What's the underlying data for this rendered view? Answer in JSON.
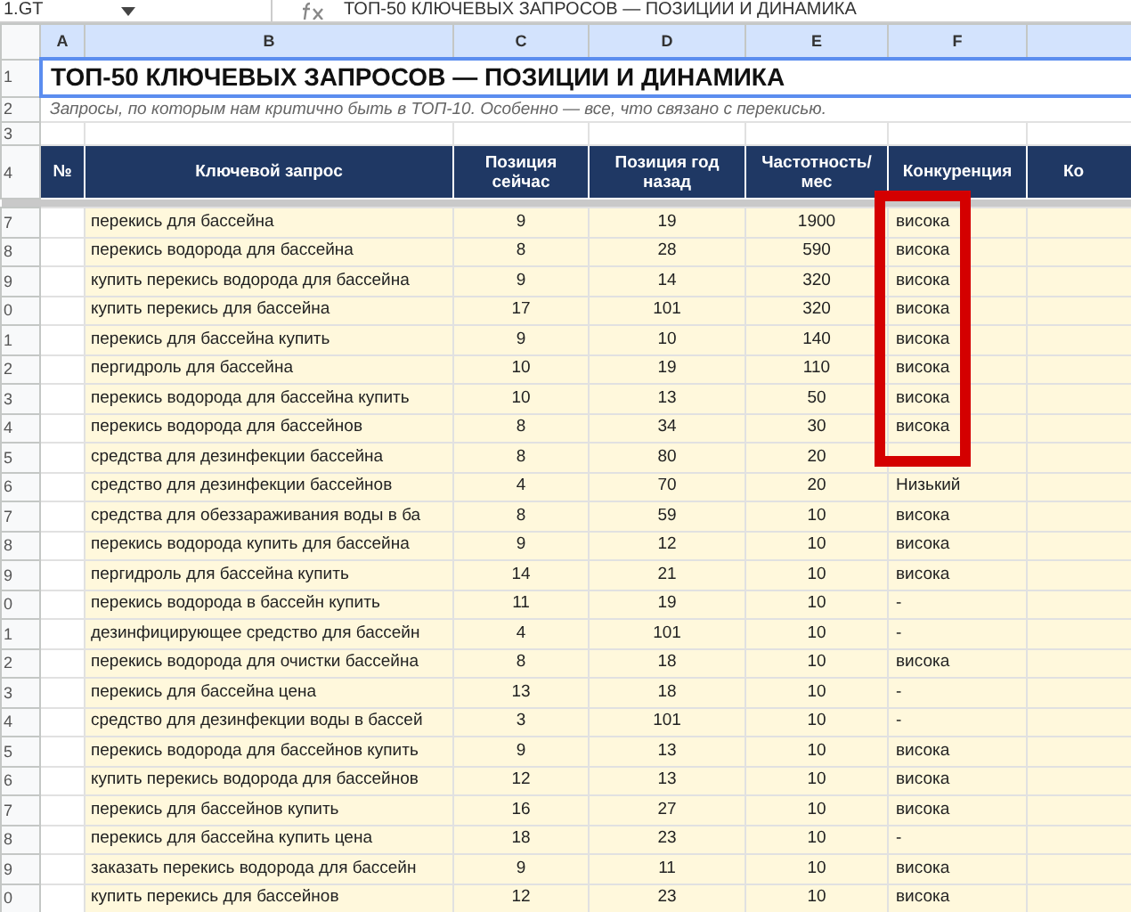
{
  "formula_bar": {
    "name_box": "1.GT",
    "formula": "ТОП-50 КЛЮЧЕВЫХ ЗАПРОСОВ — ПОЗИЦИИ И ДИНАМИКА"
  },
  "column_letters": [
    "A",
    "B",
    "C",
    "D",
    "E",
    "F"
  ],
  "title_row": {
    "row_number": "1",
    "text": "ТОП-50 КЛЮЧЕВЫХ ЗАПРОСОВ — ПОЗИЦИИ И ДИНАМИКА"
  },
  "subtitle_row": {
    "row_number": "2",
    "text": "Запросы, по которым нам критично быть в ТОП-10. Особенно — все, что связано с перекисью."
  },
  "empty_row": {
    "row_number": "3"
  },
  "header_row": {
    "row_number": "4",
    "cells": [
      "№",
      "Ключевой запрос",
      "Позиция сейчас",
      "Позиция год назад",
      "Частотность/ мес",
      "Конкуренция",
      "Ко"
    ]
  },
  "rows": [
    {
      "row_number": "7",
      "query": "перекись для бассейна",
      "position_now": "9",
      "position_year_ago": "19",
      "frequency": "1900",
      "competition": "висока"
    },
    {
      "row_number": "8",
      "query": "перекись водорода для бассейна",
      "position_now": "8",
      "position_year_ago": "28",
      "frequency": "590",
      "competition": "висока"
    },
    {
      "row_number": "9",
      "query": "купить перекись водорода для бассейна",
      "position_now": "9",
      "position_year_ago": "14",
      "frequency": "320",
      "competition": "висока"
    },
    {
      "row_number": "0",
      "query": "купить перекись для бассейна",
      "position_now": "17",
      "position_year_ago": "101",
      "frequency": "320",
      "competition": "висока"
    },
    {
      "row_number": "1",
      "query": "перекись для бассейна купить",
      "position_now": "9",
      "position_year_ago": "10",
      "frequency": "140",
      "competition": "висока"
    },
    {
      "row_number": "2",
      "query": "пергидроль для бассейна",
      "position_now": "10",
      "position_year_ago": "19",
      "frequency": "110",
      "competition": "висока"
    },
    {
      "row_number": "3",
      "query": "перекись водорода для бассейна купить",
      "position_now": "10",
      "position_year_ago": "13",
      "frequency": "50",
      "competition": "висока"
    },
    {
      "row_number": "4",
      "query": "перекись водорода для бассейнов",
      "position_now": "8",
      "position_year_ago": "34",
      "frequency": "30",
      "competition": "висока"
    },
    {
      "row_number": "5",
      "query": "средства для дезинфекции бассейна",
      "position_now": "8",
      "position_year_ago": "80",
      "frequency": "20"
    },
    {
      "row_number": "6",
      "query": "средство для дезинфекции бассейнов",
      "position_now": "4",
      "position_year_ago": "70",
      "frequency": "20",
      "competition": "Низький"
    },
    {
      "row_number": "7",
      "query": "средства для обеззараживания воды в ба",
      "position_now": "8",
      "position_year_ago": "59",
      "frequency": "10",
      "competition": "висока"
    },
    {
      "row_number": "8",
      "query": "перекись водорода купить для бассейна",
      "position_now": "9",
      "position_year_ago": "12",
      "frequency": "10",
      "competition": "висока"
    },
    {
      "row_number": "9",
      "query": "пергидроль для бассейна купить",
      "position_now": "14",
      "position_year_ago": "21",
      "frequency": "10",
      "competition": "висока"
    },
    {
      "row_number": "0",
      "query": "перекись водорода в бассейн купить",
      "position_now": "11",
      "position_year_ago": "19",
      "frequency": "10",
      "competition": "-"
    },
    {
      "row_number": "1",
      "query": "дезинфицирующее средство для бассейн",
      "position_now": "4",
      "position_year_ago": "101",
      "frequency": "10",
      "competition": "-"
    },
    {
      "row_number": "2",
      "query": "перекись водорода для очистки бассейна",
      "position_now": "8",
      "position_year_ago": "18",
      "frequency": "10",
      "competition": "висока"
    },
    {
      "row_number": "3",
      "query": "перекись для бассейна цена",
      "position_now": "13",
      "position_year_ago": "18",
      "frequency": "10",
      "competition": "-"
    },
    {
      "row_number": "4",
      "query": "средство для дезинфекции воды в бассей",
      "position_now": "3",
      "position_year_ago": "101",
      "frequency": "10",
      "competition": "-"
    },
    {
      "row_number": "5",
      "query": "перекись водорода для бассейнов купить",
      "position_now": "9",
      "position_year_ago": "13",
      "frequency": "10",
      "competition": "висока"
    },
    {
      "row_number": "6",
      "query": "купить перекись водорода для бассейнов",
      "position_now": "12",
      "position_year_ago": "13",
      "frequency": "10",
      "competition": "висока"
    },
    {
      "row_number": "7",
      "query": "перекись для бассейнов купить",
      "position_now": "16",
      "position_year_ago": "27",
      "frequency": "10",
      "competition": "висока"
    },
    {
      "row_number": "8",
      "query": "перекись для бассейна купить цена",
      "position_now": "18",
      "position_year_ago": "23",
      "frequency": "10",
      "competition": "-"
    },
    {
      "row_number": "9",
      "query": "заказать перекись водорода для бассейн",
      "position_now": "9",
      "position_year_ago": "11",
      "frequency": "10",
      "competition": "висока"
    },
    {
      "row_number": "0",
      "query": "купить перекись для бассейнов",
      "position_now": "12",
      "position_year_ago": "23",
      "frequency": "10",
      "competition": "висока"
    }
  ]
}
